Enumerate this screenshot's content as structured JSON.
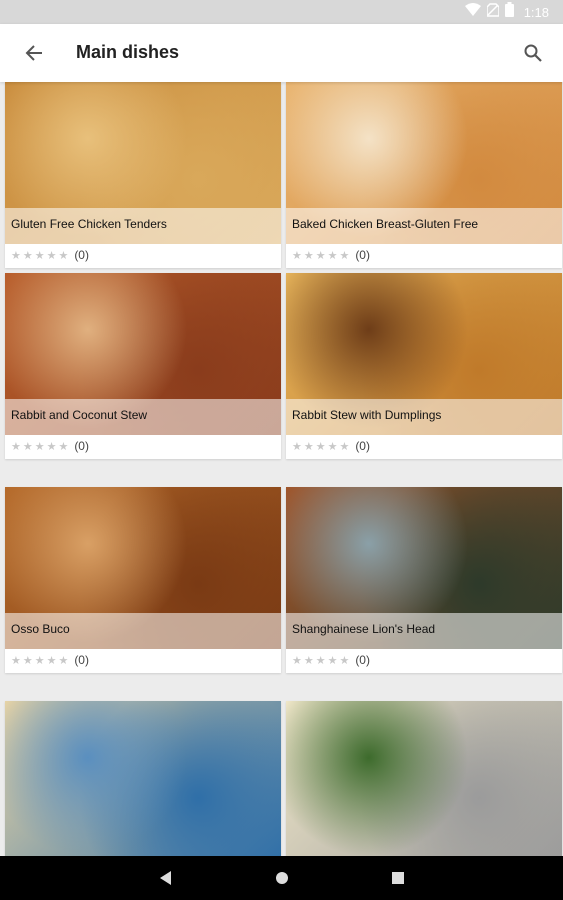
{
  "status_bar": {
    "time": "1:18",
    "icons": [
      "wifi-icon",
      "no-sim-icon",
      "battery-icon"
    ]
  },
  "app_bar": {
    "title": "Main dishes",
    "back_icon": "arrow-back-icon",
    "search_icon": "search-icon"
  },
  "recipes": [
    {
      "title": "Gluten Free Chicken Tenders",
      "stars": "★★★★★",
      "count": "(0)",
      "photo_colors": [
        "#d9a85a",
        "#c98c3d",
        "#e8c07b"
      ]
    },
    {
      "title": "Baked Chicken Breast-Gluten Free",
      "stars": "★★★★★",
      "count": "(0)",
      "photo_colors": [
        "#d28a3f",
        "#e9b46f",
        "#f4e2c6"
      ]
    },
    {
      "title": "Rabbit and Coconut Stew",
      "stars": "★★★★★",
      "count": "(0)",
      "photo_colors": [
        "#8a3c1c",
        "#b85d2b",
        "#e0b07f"
      ]
    },
    {
      "title": "Rabbit Stew with Dumplings",
      "stars": "★★★★★",
      "count": "(0)",
      "photo_colors": [
        "#c07a2a",
        "#e4b25a",
        "#6e3d18"
      ]
    },
    {
      "title": "Osso Buco",
      "stars": "★★★★★",
      "count": "(0)",
      "photo_colors": [
        "#7a3a14",
        "#b56a2a",
        "#d9a065"
      ]
    },
    {
      "title": "Shanghainese Lion's Head",
      "stars": "★★★★★",
      "count": "(0)",
      "photo_colors": [
        "#2d3a2a",
        "#a0552a",
        "#8aa0a8"
      ]
    },
    {
      "title": "",
      "stars": "",
      "count": "",
      "photo_colors": [
        "#2f6fa8",
        "#e6d3a6",
        "#5a8fbf"
      ]
    },
    {
      "title": "",
      "stars": "",
      "count": "",
      "photo_colors": [
        "#9b9b9b",
        "#efe6c8",
        "#3d6b2c"
      ]
    }
  ],
  "nav_bar": {
    "back_icon": "nav-back-icon",
    "home_icon": "nav-home-icon",
    "recents_icon": "nav-recents-icon"
  }
}
